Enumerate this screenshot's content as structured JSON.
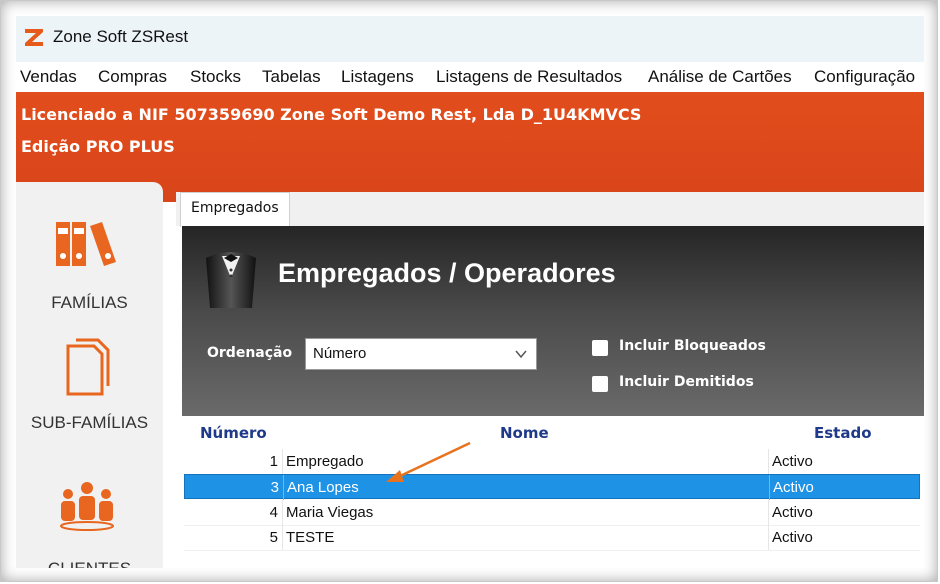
{
  "window": {
    "title": "Zone Soft ZSRest",
    "logo_icon": "z-logo-icon",
    "accent_color": "#e24d1c"
  },
  "menu": [
    "Vendas",
    "Compras",
    "Stocks",
    "Tabelas",
    "Listagens",
    "Listagens de Resultados",
    "Análise de Cartões",
    "Configuração"
  ],
  "banner": {
    "license": "Licenciado a NIF 507359690 Zone Soft Demo Rest, Lda D_1U4KMVCS",
    "edition": "Edição PRO PLUS"
  },
  "sidebar": [
    {
      "label": "FAMÍLIAS",
      "icon": "binders-icon"
    },
    {
      "label": "SUB-FAMÍLIAS",
      "icon": "documents-icon"
    },
    {
      "label": "CLIENTES",
      "icon": "people-icon"
    }
  ],
  "tab": {
    "label": "Empregados"
  },
  "header": {
    "title": "Empregados / Operadores",
    "icon": "butler-icon"
  },
  "filters": {
    "order_label": "Ordenação",
    "order_value": "Número",
    "blocked_label": "Incluir Bloqueados",
    "blocked_checked": false,
    "dismissed_label": "Incluir Demitidos",
    "dismissed_checked": false
  },
  "table": {
    "columns": [
      "Número",
      "Nome",
      "Estado"
    ],
    "rows": [
      {
        "numero": "1",
        "nome": "Empregado",
        "estado": "Activo",
        "selected": false
      },
      {
        "numero": "3",
        "nome": "Ana Lopes",
        "estado": "Activo",
        "selected": true
      },
      {
        "numero": "4",
        "nome": "Maria Viegas",
        "estado": "Activo",
        "selected": false
      },
      {
        "numero": "5",
        "nome": "TESTE",
        "estado": "Activo",
        "selected": false
      }
    ],
    "selection_color": "#1e93e6"
  }
}
